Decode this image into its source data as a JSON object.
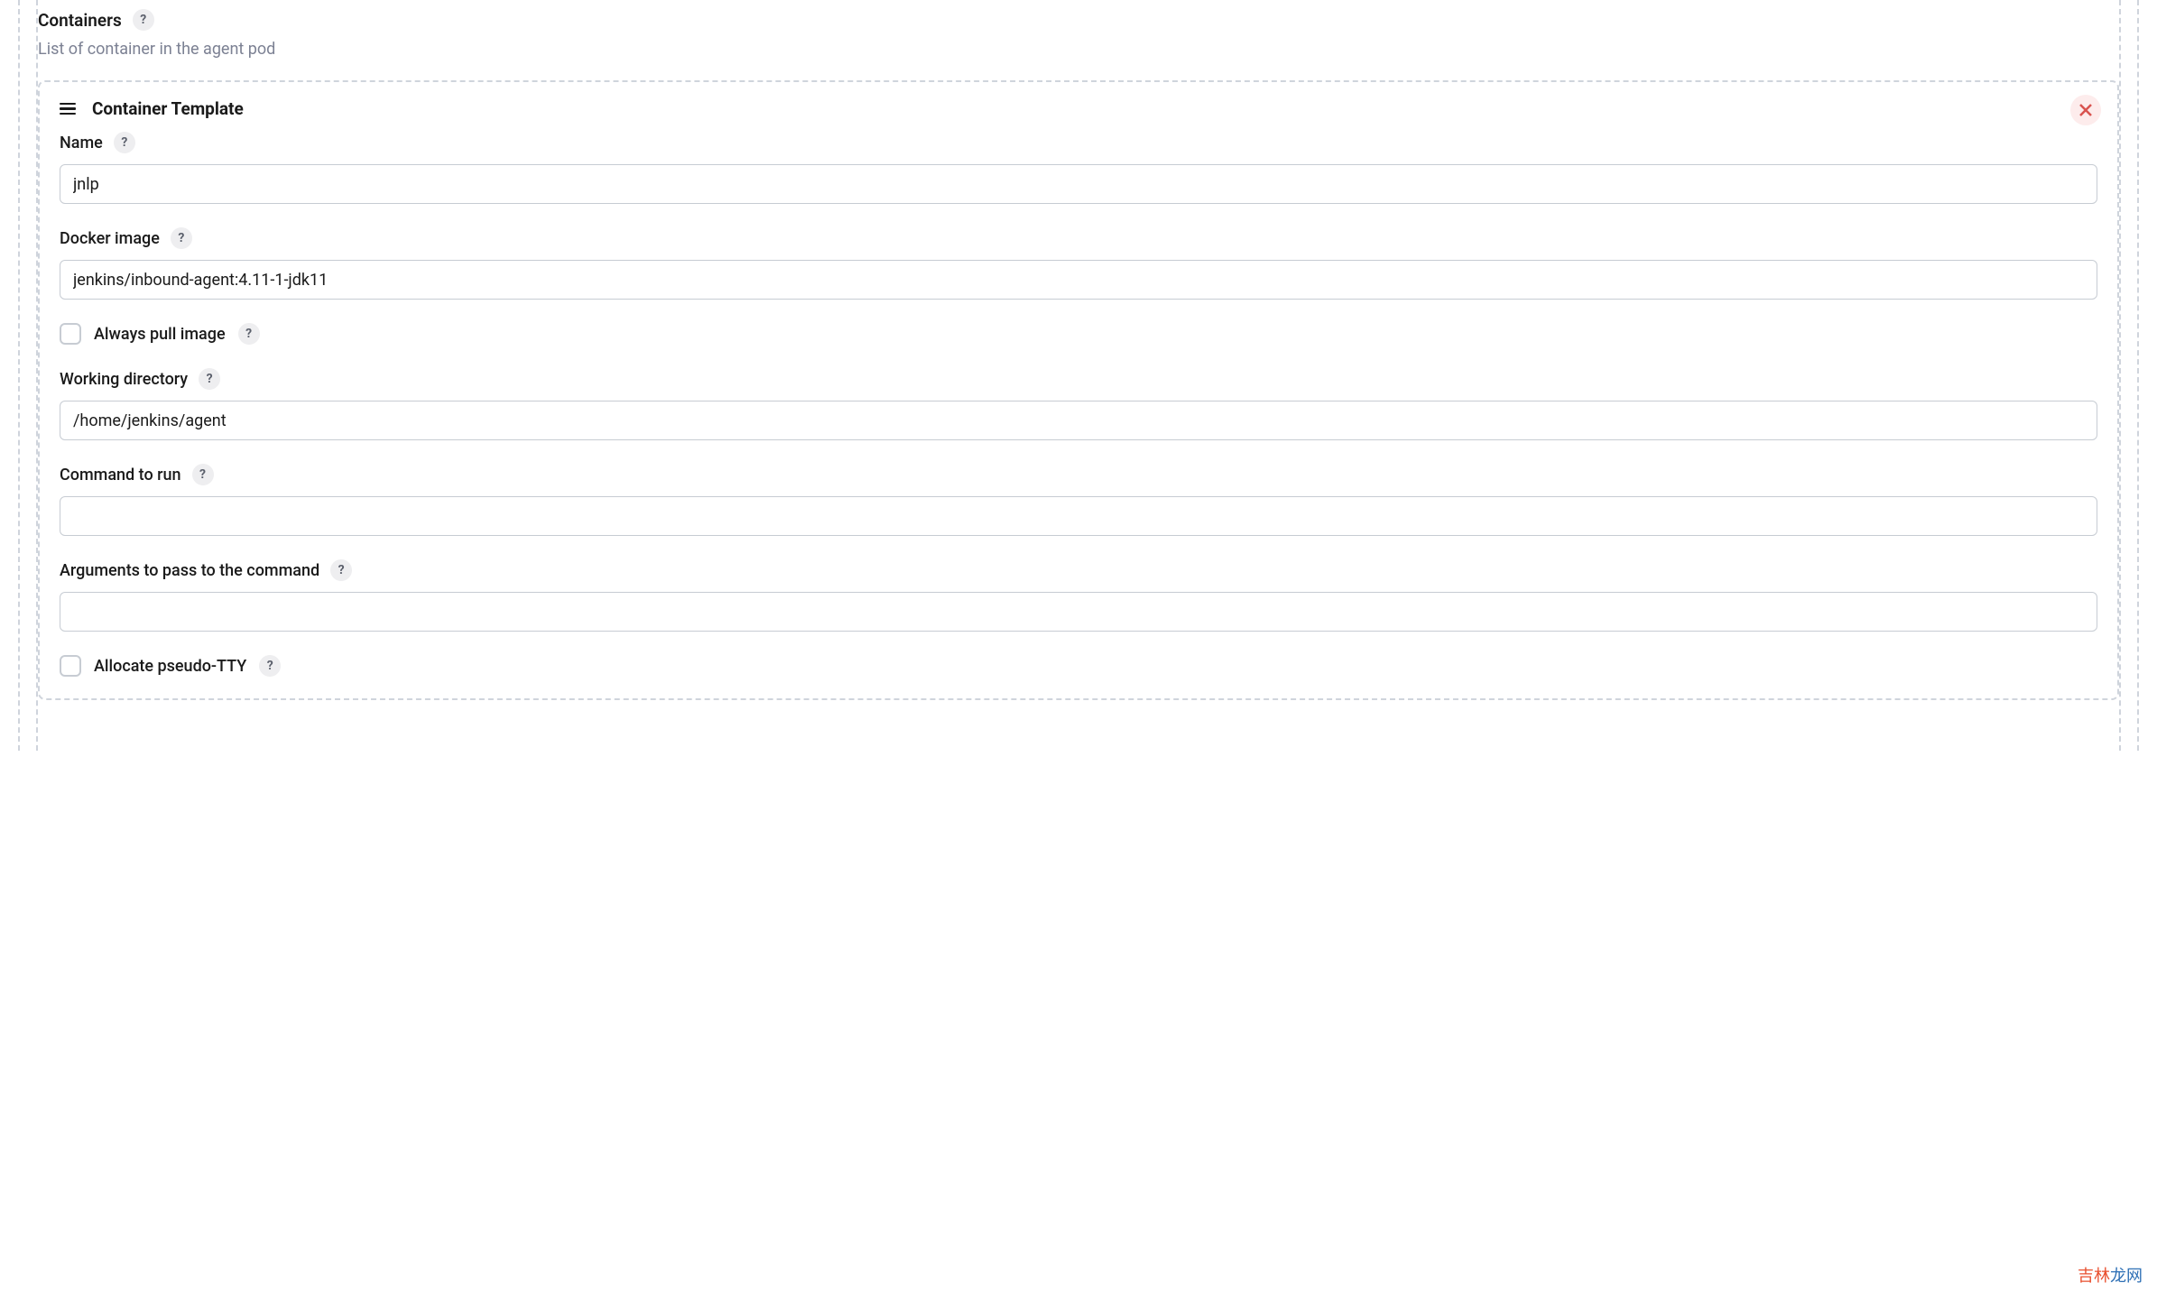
{
  "section": {
    "title": "Containers",
    "subtitle": "List of container in the agent pod"
  },
  "template": {
    "title": "Container Template",
    "fields": {
      "name": {
        "label": "Name",
        "value": "jnlp"
      },
      "docker_image": {
        "label": "Docker image",
        "value": "jenkins/inbound-agent:4.11-1-jdk11"
      },
      "always_pull": {
        "label": "Always pull image",
        "checked": false
      },
      "working_directory": {
        "label": "Working directory",
        "value": "/home/jenkins/agent"
      },
      "command": {
        "label": "Command to run",
        "value": ""
      },
      "arguments": {
        "label": "Arguments to pass to the command",
        "value": ""
      },
      "allocate_tty": {
        "label": "Allocate pseudo-TTY",
        "checked": false
      }
    }
  },
  "watermark": {
    "c1": "吉",
    "c2": "林",
    "c3": "龙",
    "c4": "网"
  }
}
